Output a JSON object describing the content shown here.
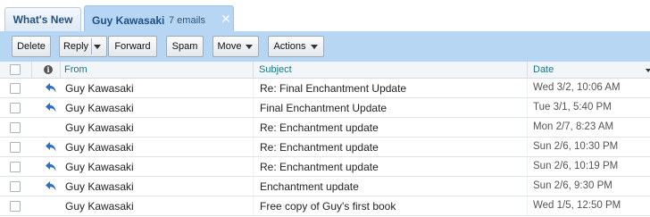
{
  "tabs": {
    "whats_new": "What's New",
    "active_name": "Guy Kawasaki",
    "active_count": "7 emails",
    "close_icon": "close-icon"
  },
  "toolbar": {
    "delete": "Delete",
    "reply": "Reply",
    "forward": "Forward",
    "spam": "Spam",
    "move": "Move",
    "actions": "Actions"
  },
  "columns": {
    "from": "From",
    "subject": "Subject",
    "date": "Date"
  },
  "colors": {
    "accent": "#b7d6f3",
    "header_text": "#0c7a8c",
    "reply_icon": "#2d6fc4"
  },
  "rows": [
    {
      "from": "Guy Kawasaki",
      "subject": "Re: Final Enchantment Update",
      "date": "Wed 3/2, 10:06 AM",
      "replied": true
    },
    {
      "from": "Guy Kawasaki",
      "subject": "Final Enchantment Update",
      "date": "Tue 3/1, 5:40 PM",
      "replied": true
    },
    {
      "from": "Guy Kawasaki",
      "subject": "Re: Enchantment update",
      "date": "Mon 2/7, 8:23 AM",
      "replied": false
    },
    {
      "from": "Guy Kawasaki",
      "subject": "Re: Enchantment update",
      "date": "Sun 2/6, 10:30 PM",
      "replied": true
    },
    {
      "from": "Guy Kawasaki",
      "subject": "Re: Enchantment update",
      "date": "Sun 2/6, 10:19 PM",
      "replied": true
    },
    {
      "from": "Guy Kawasaki",
      "subject": "Enchantment update",
      "date": "Sun 2/6, 9:30 PM",
      "replied": true
    },
    {
      "from": "Guy Kawasaki",
      "subject": "Free copy of Guy's first book",
      "date": "Wed 1/5, 12:50 PM",
      "replied": false
    }
  ]
}
